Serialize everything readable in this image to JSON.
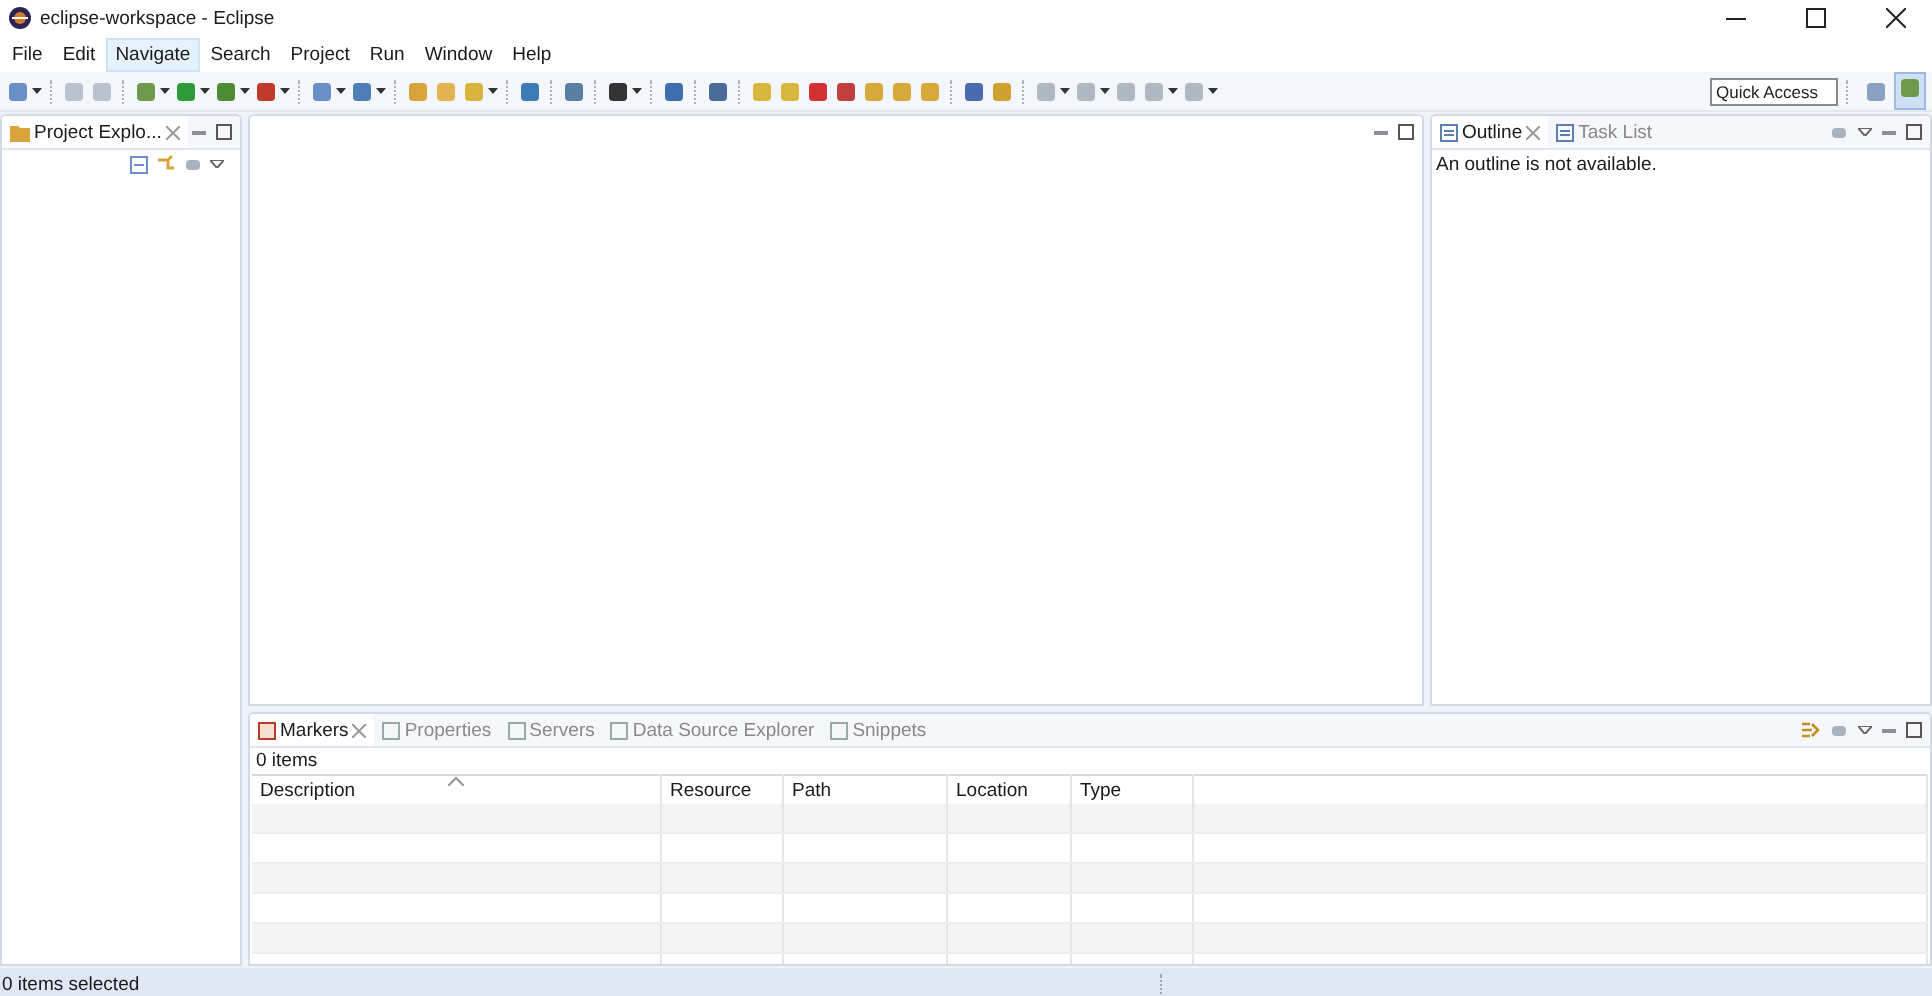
{
  "window": {
    "title": "eclipse-workspace - Eclipse"
  },
  "menu": [
    {
      "label": "File",
      "selected": false
    },
    {
      "label": "Edit",
      "selected": false
    },
    {
      "label": "Navigate",
      "selected": true
    },
    {
      "label": "Search",
      "selected": false
    },
    {
      "label": "Project",
      "selected": false
    },
    {
      "label": "Run",
      "selected": false
    },
    {
      "label": "Window",
      "selected": false
    },
    {
      "label": "Help",
      "selected": false
    }
  ],
  "quick_access": {
    "placeholder": "Quick Access"
  },
  "project_explorer": {
    "tab": "Project Explo..."
  },
  "outline_panel": {
    "tabs": [
      {
        "label": "Outline",
        "selected": true
      },
      {
        "label": "Task List",
        "selected": false
      }
    ],
    "message": "An outline is not available."
  },
  "markers_panel": {
    "tabs": [
      {
        "label": "Markers",
        "selected": true
      },
      {
        "label": "Properties",
        "selected": false
      },
      {
        "label": "Servers",
        "selected": false
      },
      {
        "label": "Data Source Explorer",
        "selected": false
      },
      {
        "label": "Snippets",
        "selected": false
      }
    ],
    "count": "0 items",
    "columns": [
      "Description",
      "Resource",
      "Path",
      "Location",
      "Type"
    ]
  },
  "status_bar": {
    "text": "0 items selected"
  }
}
